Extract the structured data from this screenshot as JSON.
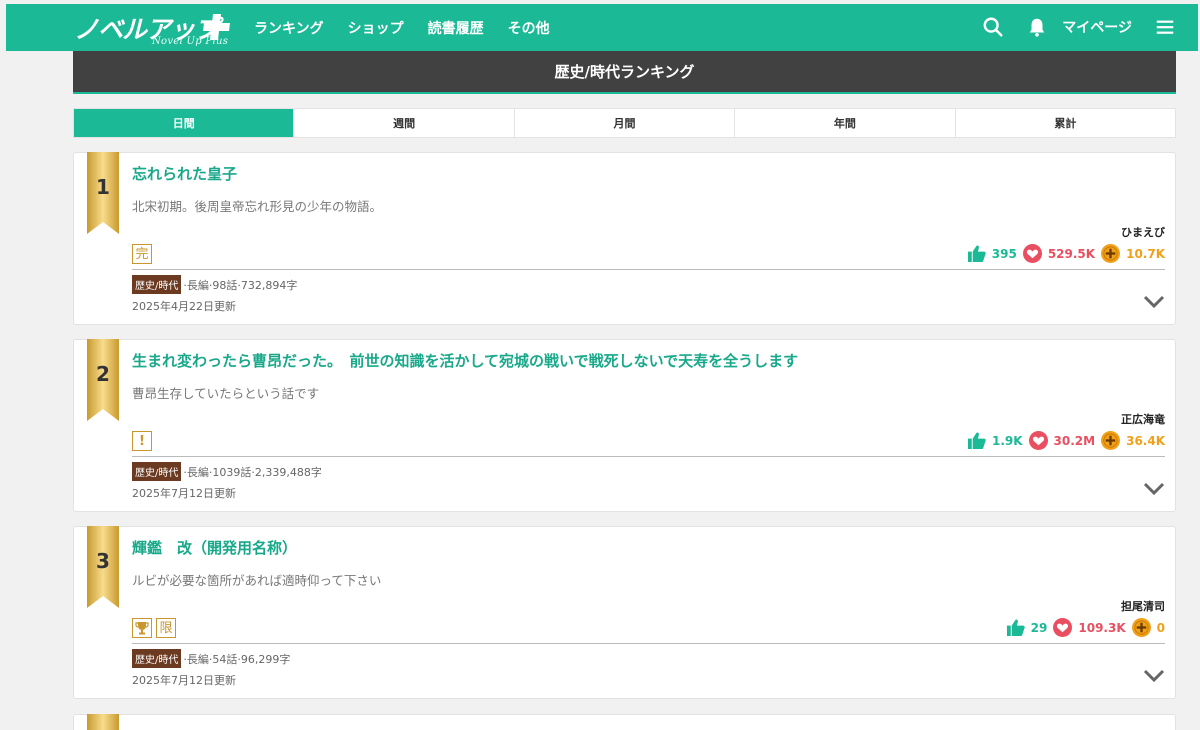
{
  "header": {
    "logo_text": "ノベルアップ",
    "logo_sub": "Novel Up Plus",
    "nav": [
      "ランキング",
      "ショップ",
      "読書履歴",
      "その他"
    ],
    "mypage_label": "マイページ",
    "search_icon": "search-icon",
    "bell_icon": "bell-icon",
    "menu_icon": "hamburger-menu-icon",
    "brand_color": "#1bb996"
  },
  "page": {
    "title": "歴史/時代ランキング"
  },
  "tabs": [
    {
      "label": "日間",
      "active": true
    },
    {
      "label": "週間",
      "active": false
    },
    {
      "label": "月間",
      "active": false
    },
    {
      "label": "年間",
      "active": false
    },
    {
      "label": "累計",
      "active": false
    }
  ],
  "rankings": [
    {
      "rank": "1",
      "title": "忘れられた皇子",
      "description": "北宋初期。後周皇帝忘れ形見の少年の物語。",
      "author": "ひまえび",
      "badges": [
        "完"
      ],
      "likes": "395",
      "hearts": "529.5K",
      "points": "10.7K",
      "genre": "歴史/時代",
      "meta": "·長編·98話·732,894字",
      "updated": "2025年4月22日更新"
    },
    {
      "rank": "2",
      "title": "生まれ変わったら曹昂だった。　前世の知識を活かして宛城の戦いで戦死しないで天寿を全うします",
      "description": "曹昂生存していたらという話です",
      "author": "正広海竜",
      "badges": [
        "!"
      ],
      "likes": "1.9K",
      "hearts": "30.2M",
      "points": "36.4K",
      "genre": "歴史/時代",
      "meta": "·長編·1039話·2,339,488字",
      "updated": "2025年7月12日更新"
    },
    {
      "rank": "3",
      "title": "輝鑑　改（開発用名称）",
      "description": "ルビが必要な箇所があれば適時仰って下さい",
      "author": "担尾清司",
      "badges": [
        "trophy",
        "限"
      ],
      "likes": "29",
      "hearts": "109.3K",
      "points": "0",
      "genre": "歴史/時代",
      "meta": "·長編·54話·96,299字",
      "updated": "2025年7月12日更新"
    }
  ]
}
